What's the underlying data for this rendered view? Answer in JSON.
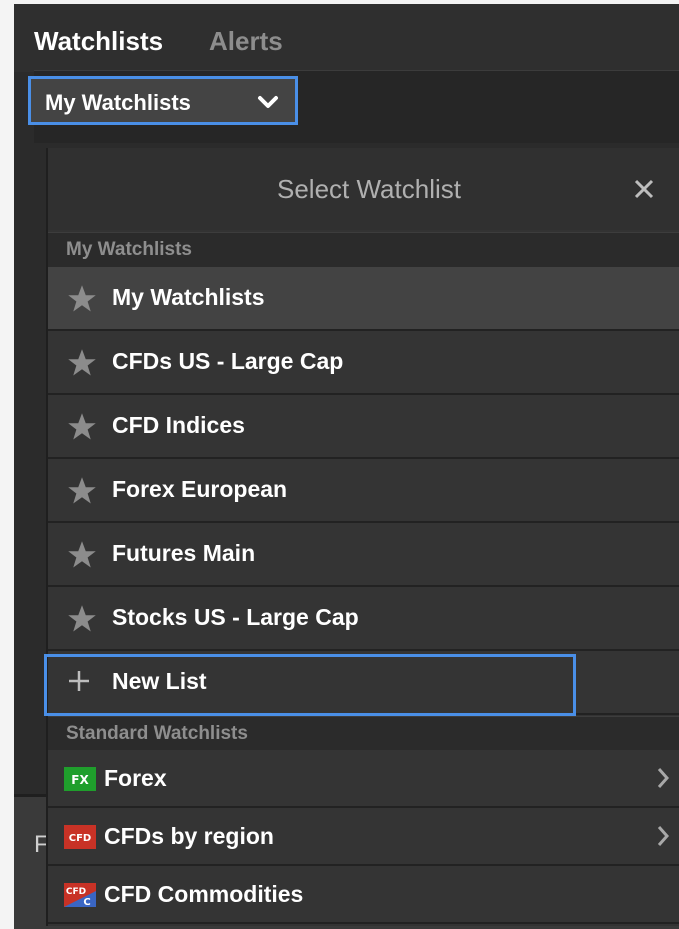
{
  "tabs": [
    {
      "label": "Watchlists"
    },
    {
      "label": "Alerts"
    }
  ],
  "selector": {
    "value": "My Watchlists"
  },
  "panel": {
    "title": "Select Watchlist",
    "my_section": {
      "header": "My Watchlists",
      "items": [
        {
          "label": "My Watchlists"
        },
        {
          "label": "CFDs US - Large Cap"
        },
        {
          "label": "CFD Indices"
        },
        {
          "label": "Forex European"
        },
        {
          "label": "Futures Main"
        },
        {
          "label": "Stocks US - Large Cap"
        }
      ],
      "new_list": "New List"
    },
    "standard_section": {
      "header": "Standard Watchlists",
      "items": [
        {
          "label": "Forex",
          "badge": "FX",
          "badge_color": "#1f9e2c"
        },
        {
          "label": "CFDs by region",
          "badge": "CFD",
          "badge_color": "#c83226"
        },
        {
          "label": "CFD Commodities",
          "badge": "CFD C",
          "badge_color": "#c83226"
        }
      ]
    }
  },
  "background": {
    "partial_letter": "F"
  },
  "colors": {
    "highlight_outline": "#4a8fe7",
    "row_bg": "#343434",
    "panel_bg": "#333333"
  }
}
